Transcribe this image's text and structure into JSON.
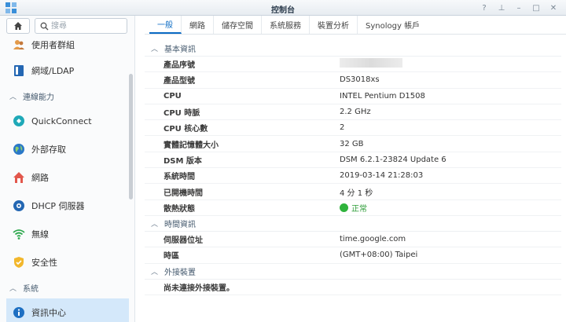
{
  "window": {
    "title": "控制台",
    "buttons": {
      "help": "?",
      "pin": "⊥",
      "minimize": "–",
      "maximize": "□",
      "close": "✕"
    }
  },
  "sidebar": {
    "search_placeholder": "搜尋",
    "items": [
      {
        "label": "使用者群組",
        "icon": "user-group-icon",
        "type": "item"
      },
      {
        "label": "網域/LDAP",
        "icon": "directory-icon",
        "type": "item"
      },
      {
        "label": "連線能力",
        "type": "section"
      },
      {
        "label": "QuickConnect",
        "icon": "quickconnect-icon",
        "type": "item"
      },
      {
        "label": "外部存取",
        "icon": "globe-icon",
        "type": "item"
      },
      {
        "label": "網路",
        "icon": "house-network-icon",
        "type": "item"
      },
      {
        "label": "DHCP 伺服器",
        "icon": "dhcp-icon",
        "type": "item"
      },
      {
        "label": "無線",
        "icon": "wifi-icon",
        "type": "item"
      },
      {
        "label": "安全性",
        "icon": "shield-icon",
        "type": "item"
      },
      {
        "label": "系統",
        "type": "section"
      },
      {
        "label": "資訊中心",
        "icon": "info-icon",
        "type": "item",
        "active": true
      }
    ]
  },
  "tabs": [
    {
      "label": "一般",
      "active": true
    },
    {
      "label": "網路"
    },
    {
      "label": "儲存空間"
    },
    {
      "label": "系統服務"
    },
    {
      "label": "裝置分析"
    },
    {
      "label": "Synology 帳戶"
    }
  ],
  "basic": {
    "title": "基本資訊",
    "rows": [
      {
        "label": "產品序號",
        "value": "",
        "redacted": true
      },
      {
        "label": "產品型號",
        "value": "DS3018xs"
      },
      {
        "label": "CPU",
        "value": "INTEL Pentium D1508"
      },
      {
        "label": "CPU 時脈",
        "value": "2.2 GHz"
      },
      {
        "label": "CPU 核心數",
        "value": "2"
      },
      {
        "label": "實體記憶體大小",
        "value": "32 GB"
      },
      {
        "label": "DSM 版本",
        "value": "DSM 6.2.1-23824 Update 6"
      },
      {
        "label": "系統時間",
        "value": "2019-03-14 21:28:03"
      },
      {
        "label": "已開機時間",
        "value": "4 分 1 秒"
      },
      {
        "label": "散熱狀態",
        "value": "正常",
        "status": true
      }
    ]
  },
  "time": {
    "title": "時間資訊",
    "rows": [
      {
        "label": "伺服器位址",
        "value": "time.google.com"
      },
      {
        "label": "時區",
        "value": "(GMT+08:00) Taipei"
      }
    ]
  },
  "external": {
    "title": "外接裝置",
    "rows": [
      {
        "label": "尚未連接外接裝置。",
        "value": ""
      }
    ]
  },
  "colors": {
    "accent": "#0b6bc4",
    "active_bg": "#d4e8fa",
    "ok": "#2fb33c"
  }
}
